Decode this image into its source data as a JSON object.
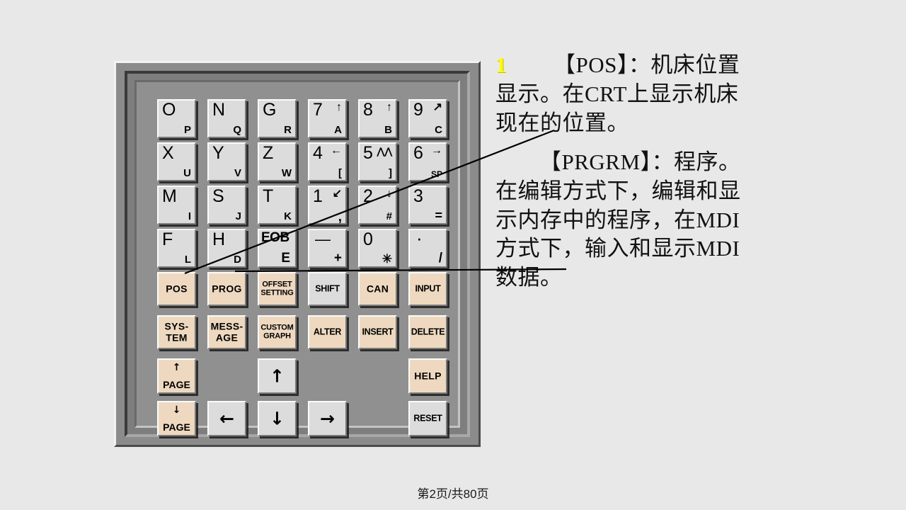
{
  "slide": {
    "background_color": "#e8e8e8",
    "footer": "第2页/共80页"
  },
  "panel": {
    "name": "FANUC CNC MDI keypad",
    "body_color": "#8b8b8b",
    "key_grey": "#dcdcdc",
    "key_tan": "#eed9c0"
  },
  "keys": {
    "char_rows": [
      [
        {
          "main": "O",
          "sub": "P"
        },
        {
          "main": "N",
          "sub": "Q"
        },
        {
          "main": "G",
          "sub": "R"
        },
        {
          "main": "7",
          "sym": "↑",
          "sub": "A"
        },
        {
          "main": "8",
          "sym": "↑",
          "sub": "B"
        },
        {
          "main": "9",
          "sym": "↗",
          "sub": "C"
        }
      ],
      [
        {
          "main": "X",
          "sub": "U"
        },
        {
          "main": "Y",
          "sub": "V"
        },
        {
          "main": "Z",
          "sub": "W"
        },
        {
          "main": "4",
          "sym": "←",
          "sub": "["
        },
        {
          "main": "5",
          "sym": "⋀⋀",
          "sub": "]"
        },
        {
          "main": "6",
          "sym": "→",
          "sub": "SP"
        }
      ],
      [
        {
          "main": "M",
          "sub": "I"
        },
        {
          "main": "S",
          "sub": "J"
        },
        {
          "main": "T",
          "sub": "K"
        },
        {
          "main": "1",
          "sym": "↙",
          "sub": ","
        },
        {
          "main": "2",
          "sym": "↓",
          "sub": "#"
        },
        {
          "main": "3",
          "sub": "="
        }
      ],
      [
        {
          "main": "F",
          "sub": "L"
        },
        {
          "main": "H",
          "sub": "D"
        },
        {
          "eob_top": "EOB",
          "eob_bot": "E"
        },
        {
          "main": "—",
          "sub": "+"
        },
        {
          "main": "0",
          "sub": "✳"
        },
        {
          "main": "·",
          "sub": "/"
        }
      ]
    ],
    "fn_row1": [
      {
        "label": "POS",
        "color": "tan"
      },
      {
        "label": "PROG",
        "color": "tan"
      },
      {
        "label": "OFFSET\nSETTING",
        "color": "tan"
      },
      {
        "label": "SHIFT",
        "color": "grey"
      },
      {
        "label": "CAN",
        "color": "tan"
      },
      {
        "label": "INPUT",
        "color": "tan"
      }
    ],
    "fn_row2": [
      {
        "label": "SYS-\nTEM",
        "color": "tan"
      },
      {
        "label": "MESS-\nAGE",
        "color": "tan"
      },
      {
        "label": "CUSTOM\nGRAPH",
        "color": "tan"
      },
      {
        "label": "ALTER",
        "color": "tan"
      },
      {
        "label": "INSERT",
        "color": "tan"
      },
      {
        "label": "DELETE",
        "color": "tan"
      }
    ],
    "page_up": {
      "arrow": "↑",
      "label": "PAGE",
      "color": "tan"
    },
    "page_down": {
      "arrow": "↓",
      "label": "PAGE",
      "color": "tan"
    },
    "cursor_up": "↑",
    "cursor_down": "↓",
    "cursor_left": "←",
    "cursor_right": "→",
    "help": {
      "label": "HELP",
      "color": "tan"
    },
    "reset": {
      "label": "RESET",
      "color": "grey"
    }
  },
  "text": {
    "bullet_number": "1",
    "paragraph1_head": "【POS】：",
    "paragraph1_body": "机床位置显示。在CRT上显示机床现在的位置。",
    "paragraph2_head": "【PRGRM】：",
    "paragraph2_body": "程序。在编辑方式下，编辑和显示内存中的程序，在MDI方式下，输入和显示MDI数据。"
  }
}
